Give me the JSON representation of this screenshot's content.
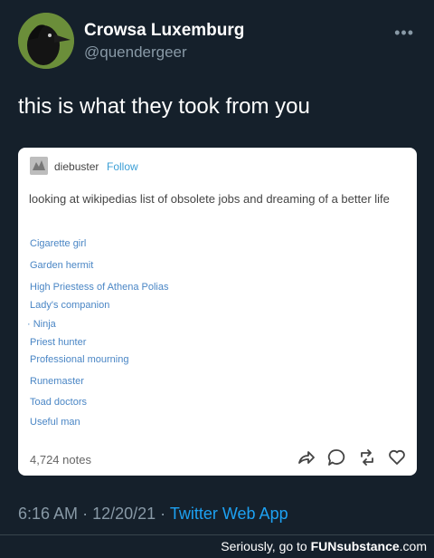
{
  "tweet": {
    "display_name": "Crowsa Luxemburg",
    "handle": "@quendergeer",
    "text": "this is what they took from you",
    "time": "6:16 AM",
    "date": "12/20/21",
    "separator": "·",
    "source": "Twitter Web App"
  },
  "embed": {
    "blog_name": "diebuster",
    "follow_label": "Follow",
    "body": "looking at wikipedias list of obsolete jobs and dreaming of a better life",
    "jobs": [
      "Cigarette girl",
      "Garden hermit",
      "High Priestess of Athena Polias",
      "Lady's companion",
      "· Ninja",
      "Priest hunter",
      "Professional mourning",
      "Runemaster",
      "Toad doctors",
      "Useful man"
    ],
    "notes": "4,724 notes",
    "actions": [
      "share-icon",
      "reply-icon",
      "reblog-icon",
      "like-icon"
    ]
  },
  "footer": {
    "prefix": "Seriously, go to",
    "brand": "FUNsubstance",
    "suffix": ".com"
  },
  "colors": {
    "background": "#15202b",
    "link": "#1da1f2",
    "muted": "#8899a6",
    "tumblr_link": "#4a86c5"
  }
}
